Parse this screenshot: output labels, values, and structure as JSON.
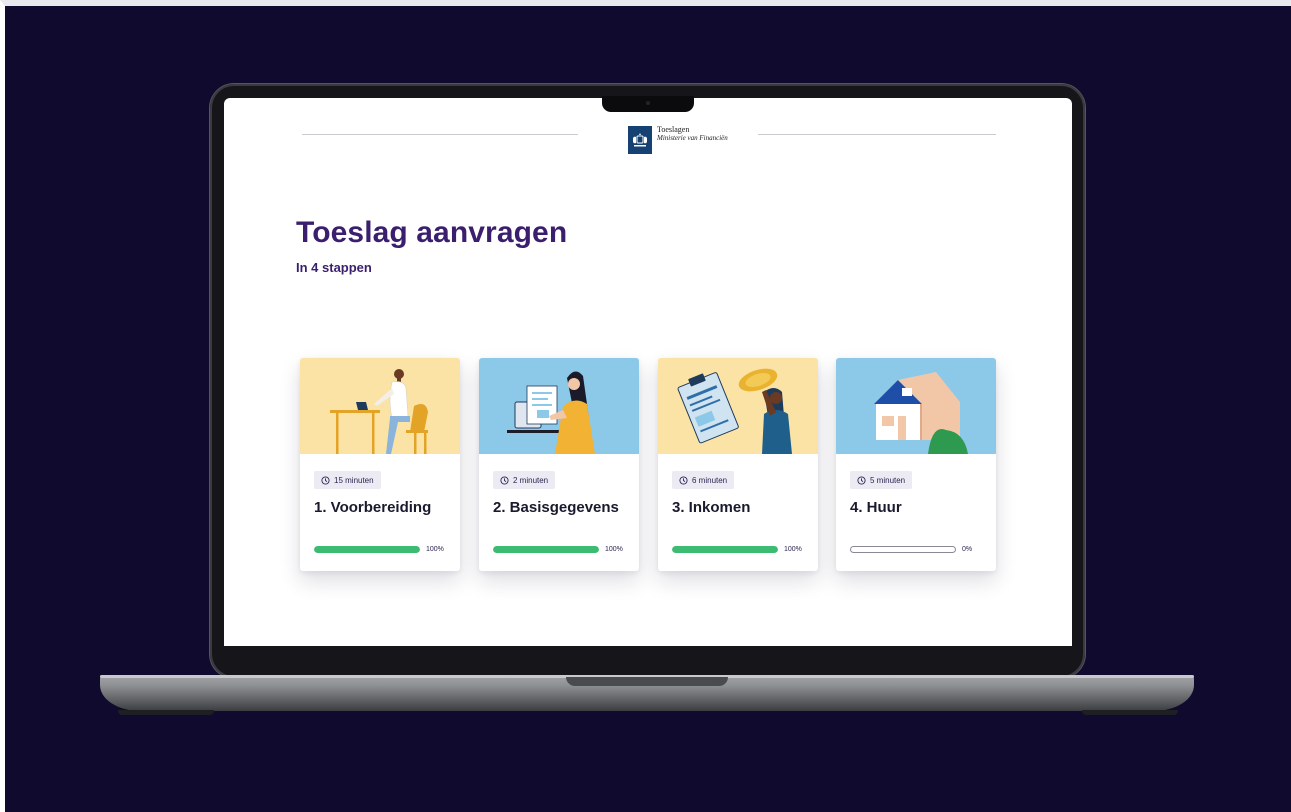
{
  "header": {
    "logo_line1": "Toeslagen",
    "logo_line2": "Ministerie van Financiën"
  },
  "page": {
    "title": "Toeslag aanvragen",
    "subtitle": "In 4 stappen"
  },
  "steps": [
    {
      "duration": "15 minuten",
      "title": "1. Voorbereiding",
      "progress_label": "100%",
      "progress": 1.0,
      "illustration": "person-at-desk-illustration",
      "bg": "#fbe3a6"
    },
    {
      "duration": "2 minuten",
      "title": "2. Basisgegevens",
      "progress_label": "100%",
      "progress": 1.0,
      "illustration": "woman-with-laptop-illustration",
      "bg": "#8cc8e8"
    },
    {
      "duration": "6 minuten",
      "title": "3. Inkomen",
      "progress_label": "100%",
      "progress": 1.0,
      "illustration": "clipboard-coin-illustration",
      "bg": "#fbe3a6"
    },
    {
      "duration": "5 minuten",
      "title": "4. Huur",
      "progress_label": "0%",
      "progress": 0.0,
      "illustration": "house-illustration",
      "bg": "#8cc8e8"
    }
  ],
  "colors": {
    "brand_purple": "#3b1f6e",
    "progress_green": "#3dbb72",
    "background": "#0f0a2e",
    "logo_blue": "#154273"
  }
}
